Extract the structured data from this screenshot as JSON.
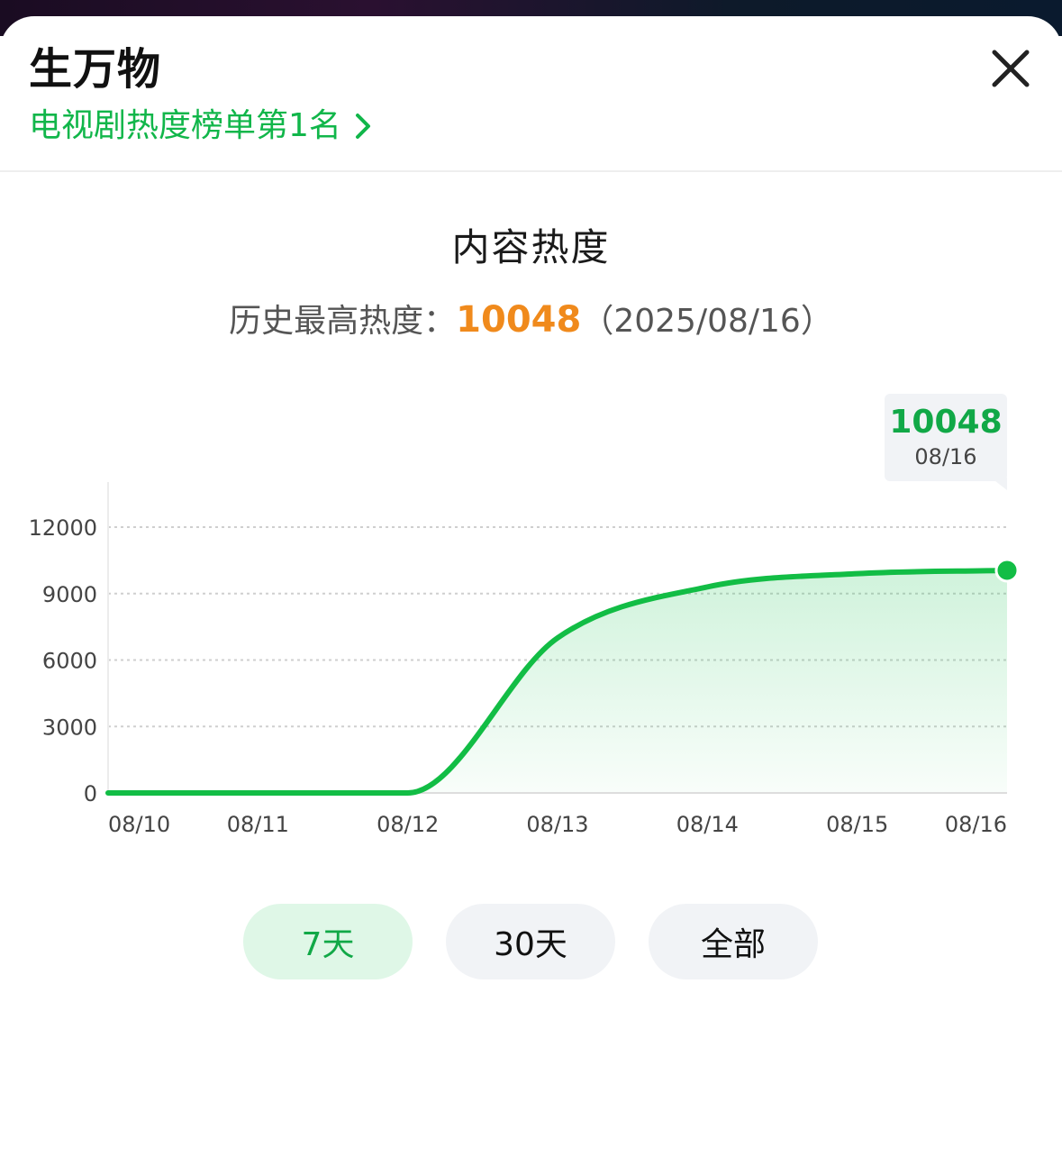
{
  "header": {
    "title": "生万物",
    "rank_link": "电视剧热度榜单第1名"
  },
  "section": {
    "title": "内容热度",
    "peak_label": "历史最高热度：",
    "peak_value": "10048",
    "peak_date": "（2025/08/16）"
  },
  "tooltip": {
    "value": "10048",
    "date": "08/16"
  },
  "range_buttons": [
    {
      "label": "7天",
      "active": true
    },
    {
      "label": "30天",
      "active": false
    },
    {
      "label": "全部",
      "active": false
    }
  ],
  "colors": {
    "accent_green": "#11b64a",
    "peak_orange": "#f08a1c",
    "grid": "#d9d9d9"
  },
  "chart_data": {
    "type": "area",
    "categories": [
      "08/10",
      "08/11",
      "08/12",
      "08/13",
      "08/14",
      "08/15",
      "08/16"
    ],
    "series": [
      {
        "values": [
          0,
          0,
          0,
          7000,
          9300,
          9900,
          10048
        ]
      }
    ],
    "yticks": [
      "0",
      "3000",
      "6000",
      "9000",
      "12000"
    ],
    "ylim": [
      0,
      12000
    ],
    "grid": true,
    "highlight_last_point": true
  }
}
